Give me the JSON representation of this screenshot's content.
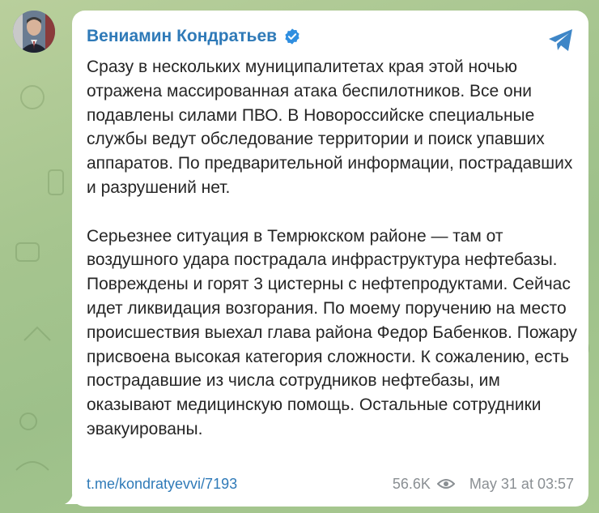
{
  "colors": {
    "accent": "#2f7ab8",
    "text": "#262626",
    "meta": "#8a8f93",
    "bubble": "#ffffff",
    "background": "#a6c58f"
  },
  "post": {
    "author": "Вениамин Кондратьев",
    "verified_icon": "verified-badge-icon",
    "share_icon": "telegram-share-icon",
    "paragraph_1": "Сразу в нескольких муниципалитетах края этой ночью отражена массированная атака беспилотников. Все они подавлены силами ПВО. В Новороссийске специальные службы ведут обследование территории и поиск упавших аппаратов. По предварительной информации, пострадавших и разрушений нет.",
    "paragraph_2": "Серьезнее ситуация в Темрюкском районе — там от воздушного удара пострадала инфраструктура нефтебазы. Повреждены и горят 3 цистерны с нефтепродуктами. Сейчас идет ликвидация возгорания. По моему поручению на место происшествия выехал глава района Федор Бабенков. Пожару присвоена высокая категория сложности. К сожалению, есть пострадавшие из числа сотрудников нефтебазы, им оказывают медицинскую помощь. Остальные сотрудники эвакуированы.",
    "link": "t.me/kondratyevvi/7193",
    "views": "56.6K",
    "views_icon": "eye-icon",
    "date": "May 31 at 03:57"
  }
}
